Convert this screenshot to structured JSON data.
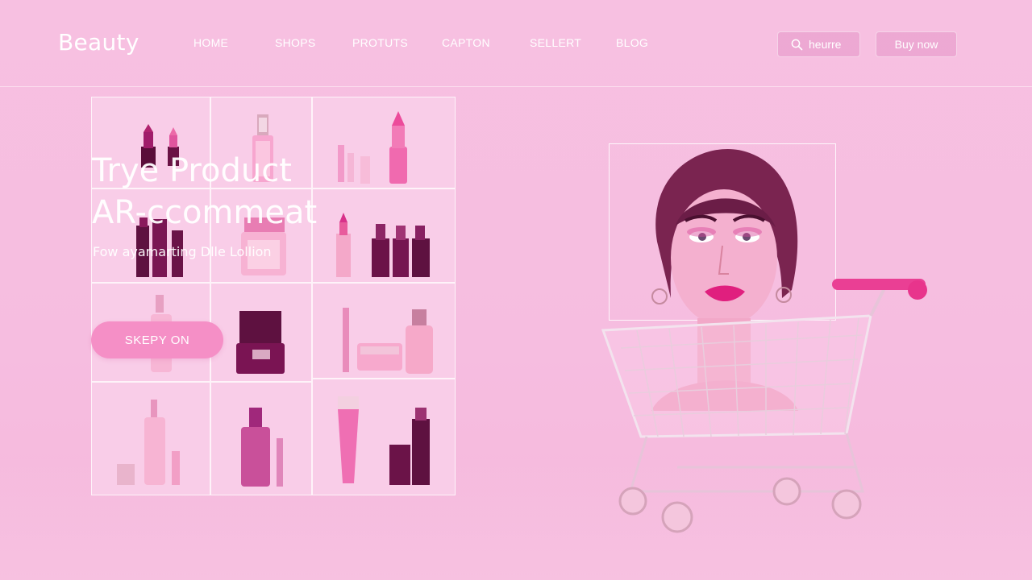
{
  "header": {
    "logo": "Beauty",
    "nav": [
      "HOME",
      "SHOPS",
      "PROTUTS",
      "CAPTON",
      "SELLERT",
      "BLOG"
    ],
    "search_label": "heurre",
    "buy_label": "Buy now"
  },
  "hero": {
    "title_line1": "Trye Product",
    "title_line2": "AR-ccommeat",
    "subtitle": "Fow ayamarting Dlle Lollion",
    "cta_label": "SKEPY ON"
  },
  "colors": {
    "background": "#f6bde0",
    "accent": "#f58fc6",
    "product_dark": "#7a1450",
    "product_pink": "#ec5aa8"
  },
  "icons": {
    "search": "search-icon",
    "cart": "shopping-cart-icon"
  }
}
